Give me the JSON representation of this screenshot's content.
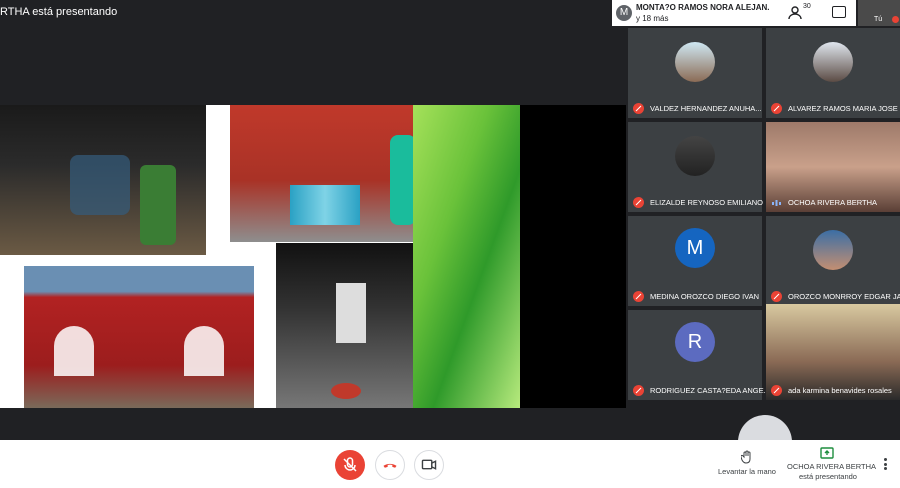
{
  "presenter_banner": "RTHA está presentando",
  "pinned": {
    "avatar_letter": "M",
    "name": "MONTA?O RAMOS NORA ALEJAN...",
    "more": "y 18 más"
  },
  "header": {
    "people_count": "30",
    "self_label": "Tú"
  },
  "participants": [
    {
      "name": "VALDEZ HERNANDEZ ANUHA...",
      "muted": true
    },
    {
      "name": "ALVAREZ RAMOS MARIA JOSE",
      "muted": true
    },
    {
      "name": "ELIZALDE REYNOSO EMILIANO",
      "muted": true
    },
    {
      "name": "OCHOA RIVERA BERTHA",
      "muted": false
    },
    {
      "name": "MEDINA OROZCO DIEGO IVAN",
      "muted": true,
      "avatar_letter": "M",
      "avatar_color": "#1565c0"
    },
    {
      "name": "OROZCO MONRROY EDGAR JA...",
      "muted": true
    },
    {
      "name": "RODRIGUEZ CASTA?EDA ANGE...",
      "muted": true,
      "avatar_letter": "R",
      "avatar_color": "#5c6bc0"
    },
    {
      "name": "ada karmina benavides rosales",
      "muted": true
    }
  ],
  "bottom": {
    "raise_hand_label": "Levantar la mano",
    "presenter_name": "OCHOA RIVERA BERTHA",
    "presenter_status": "está presentando"
  },
  "colors": {
    "accent_red": "#ea4335",
    "green": "#1e8e3e",
    "bg": "#202124"
  }
}
